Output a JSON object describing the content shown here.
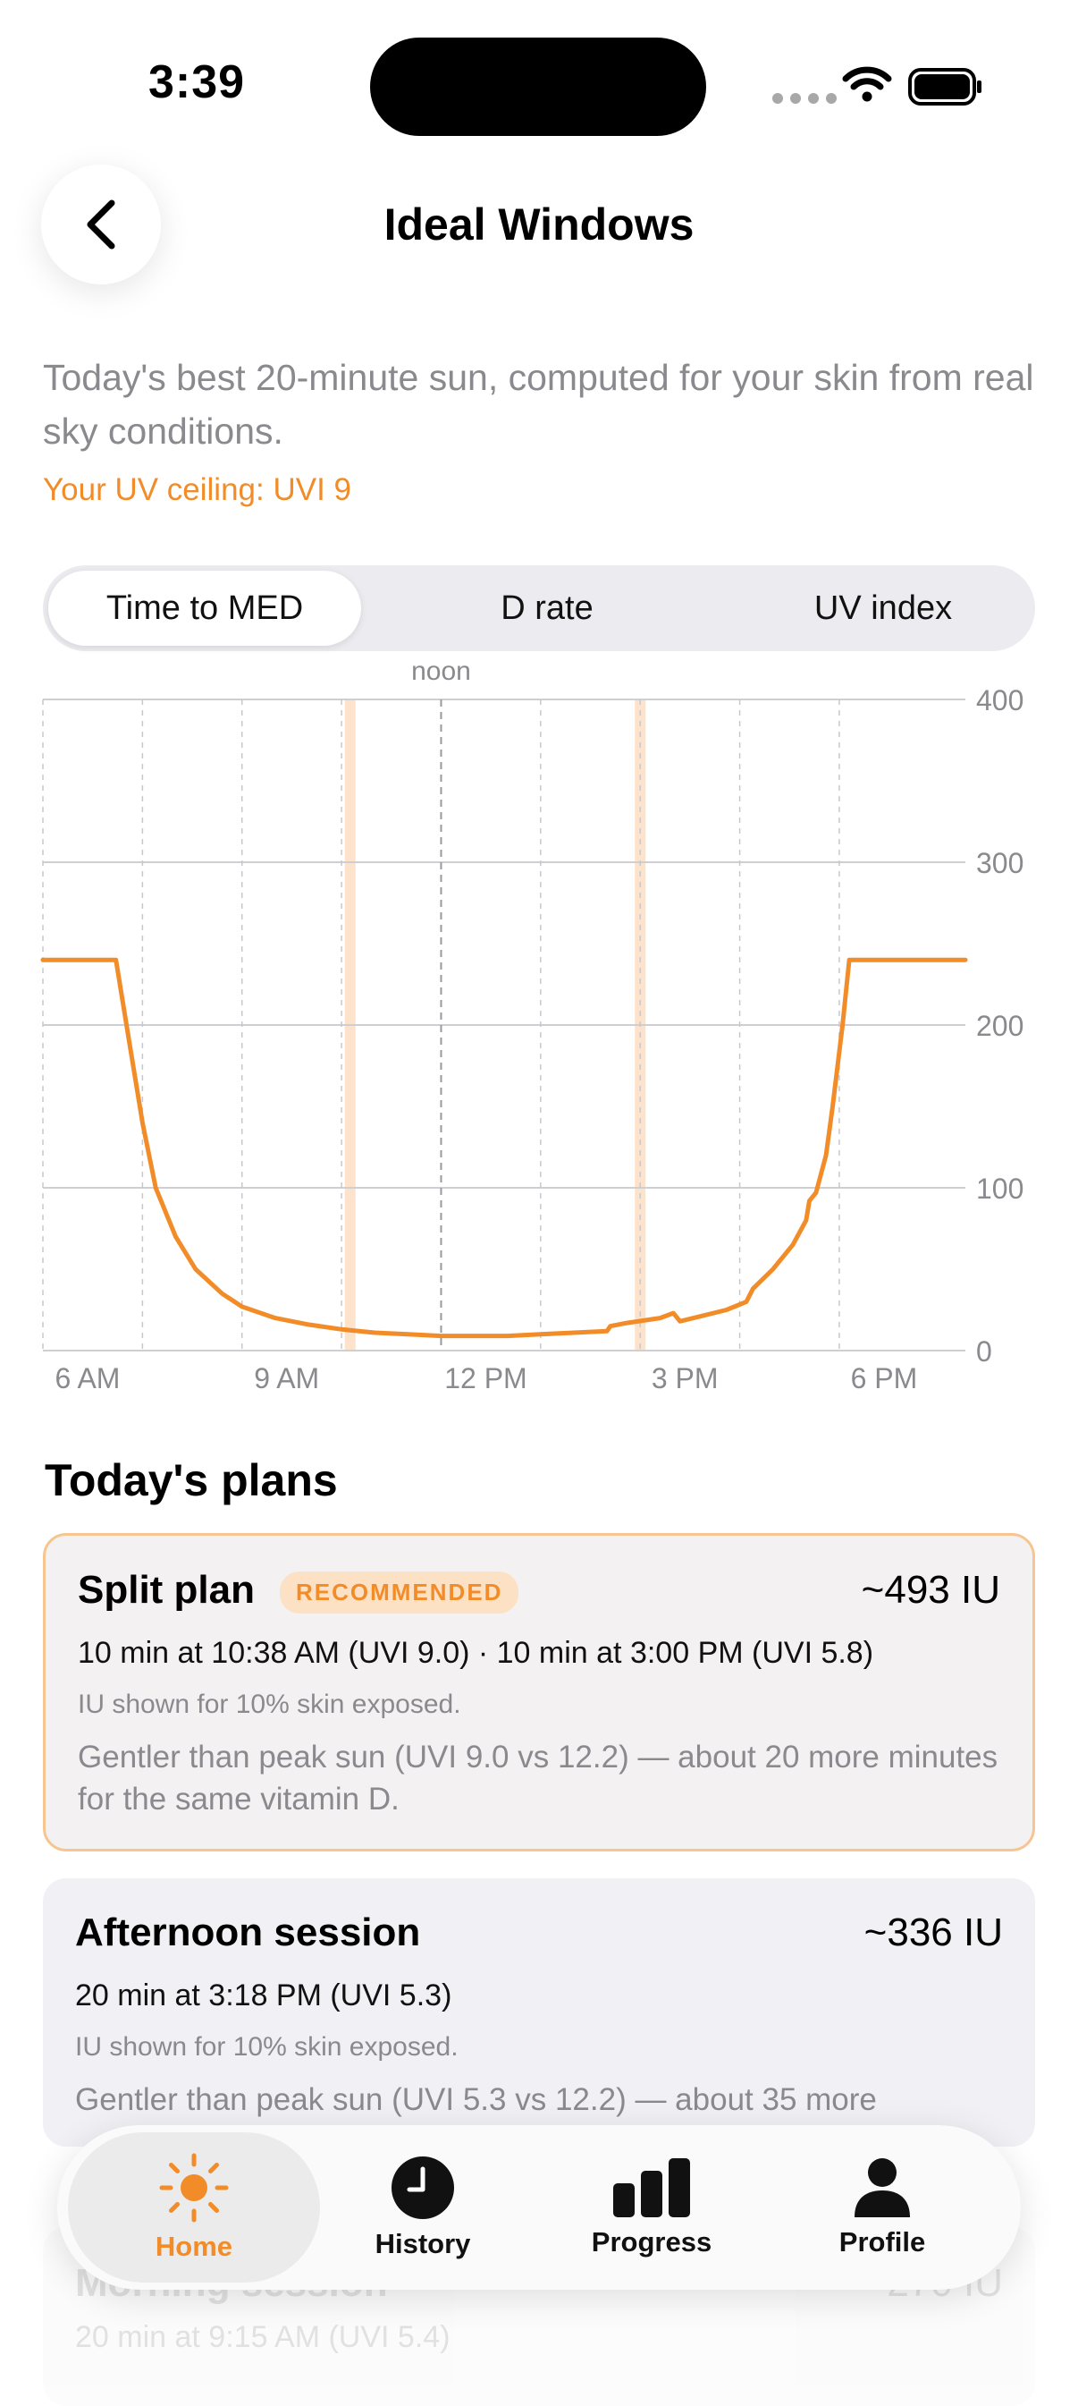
{
  "status": {
    "time": "3:39"
  },
  "header": {
    "title": "Ideal Windows"
  },
  "intro": {
    "text": "Today's best 20-minute sun, computed for your skin from real sky conditions.",
    "ceiling": "Your UV ceiling: UVI 9"
  },
  "segments": [
    "Time to MED",
    "D rate",
    "UV index"
  ],
  "selected_segment": "Time to MED",
  "chart_data": {
    "type": "line",
    "title": "",
    "xlabel": "",
    "ylabel": "",
    "x_ticks": [
      "6 AM",
      "9 AM",
      "12 PM",
      "3 PM",
      "6 PM"
    ],
    "y_ticks": [
      "0",
      "100",
      "200",
      "300",
      "400"
    ],
    "ylim": [
      0,
      400
    ],
    "x_range_hours": [
      6,
      19.9
    ],
    "grid": true,
    "noon_label": "noon",
    "highlight_windows_hours": [
      10.63,
      15.0
    ],
    "series": [
      {
        "color": "#f28c28",
        "points": [
          [
            6.0,
            240
          ],
          [
            7.1,
            240
          ],
          [
            7.3,
            190
          ],
          [
            7.5,
            140
          ],
          [
            7.7,
            100
          ],
          [
            8.0,
            70
          ],
          [
            8.3,
            50
          ],
          [
            8.7,
            35
          ],
          [
            9.0,
            27
          ],
          [
            9.5,
            20
          ],
          [
            10.0,
            16
          ],
          [
            10.5,
            13
          ],
          [
            11.0,
            11
          ],
          [
            11.5,
            10
          ],
          [
            12.0,
            9
          ],
          [
            12.5,
            9
          ],
          [
            13.0,
            9
          ],
          [
            13.5,
            10
          ],
          [
            14.0,
            11
          ],
          [
            14.5,
            12
          ],
          [
            14.55,
            15
          ],
          [
            14.8,
            17
          ],
          [
            15.3,
            20
          ],
          [
            15.5,
            23
          ],
          [
            15.6,
            18
          ],
          [
            15.9,
            21
          ],
          [
            16.3,
            25
          ],
          [
            16.6,
            30
          ],
          [
            16.7,
            38
          ],
          [
            17.0,
            50
          ],
          [
            17.3,
            65
          ],
          [
            17.5,
            80
          ],
          [
            17.55,
            92
          ],
          [
            17.65,
            97
          ],
          [
            17.8,
            120
          ],
          [
            17.9,
            150
          ],
          [
            18.05,
            200
          ],
          [
            18.15,
            240
          ],
          [
            19.9,
            240
          ]
        ]
      }
    ]
  },
  "plans": {
    "heading": "Today's plans",
    "items": [
      {
        "title": "Split plan",
        "badge": "RECOMMENDED",
        "iu": "~493 IU",
        "detail": "10 min at 10:38 AM (UVI 9.0) · 10 min at 3:00 PM (UVI 5.8)",
        "note": "IU shown for 10% skin exposed.",
        "desc": "Gentler than peak sun (UVI 9.0 vs 12.2) — about 20 more minutes for the same vitamin D."
      },
      {
        "title": "Afternoon session",
        "iu": "~336 IU",
        "detail": "20 min at 3:18 PM (UVI 5.3)",
        "note": "IU shown for 10% skin exposed.",
        "desc": "Gentler than peak sun (UVI 5.3 vs 12.2) — about 35 more"
      },
      {
        "title": "Morning session",
        "iu": "~270 IU",
        "detail": "20 min at 9:15 AM (UVI 5.4)"
      }
    ]
  },
  "tabs": [
    {
      "label": "Home",
      "icon": "sun-icon",
      "active": true
    },
    {
      "label": "History",
      "icon": "clock-icon",
      "active": false
    },
    {
      "label": "Progress",
      "icon": "bar-chart-icon",
      "active": false
    },
    {
      "label": "Profile",
      "icon": "person-icon",
      "active": false
    }
  ],
  "colors": {
    "accent": "#f28c28",
    "highlight": "#fde3cc"
  }
}
